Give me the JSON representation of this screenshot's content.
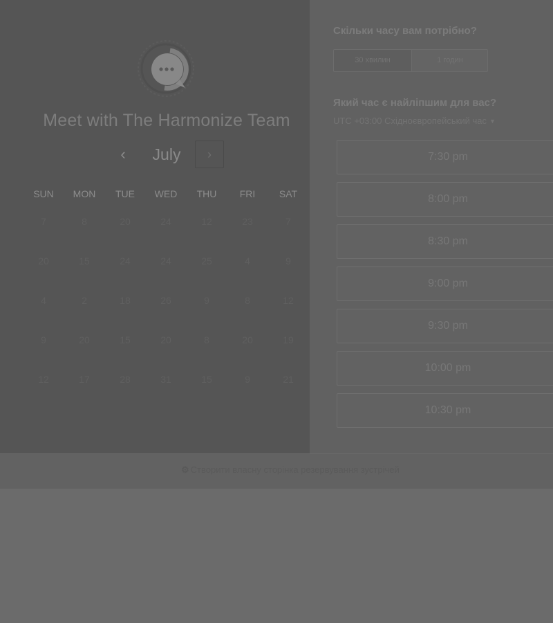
{
  "scheduler": {
    "title": "Meet with The Harmonize Team",
    "month": "July",
    "prev_icon": "‹",
    "next_icon": "›",
    "weekdays": [
      "SUN",
      "MON",
      "TUE",
      "WED",
      "THU",
      "FRI",
      "SAT"
    ],
    "weeks": [
      [
        "7",
        "8",
        "20",
        "24",
        "12",
        "23",
        "7"
      ],
      [
        "20",
        "15",
        "24",
        "24",
        "25",
        "4",
        "9"
      ],
      [
        "4",
        "2",
        "18",
        "26",
        "9",
        "8",
        "12"
      ],
      [
        "9",
        "20",
        "15",
        "20",
        "8",
        "20",
        "19"
      ],
      [
        "12",
        "17",
        "28",
        "31",
        "15",
        "9",
        "21"
      ]
    ]
  },
  "booking": {
    "duration_question": "Скільки часу вам потрібно?",
    "durations": [
      "30 хвилин",
      "1 годин"
    ],
    "time_question": "Який час є найліпшим для вас?",
    "timezone": "UTC +03:00 Східноєвропейський час",
    "slots": [
      "7:30 pm",
      "8:00 pm",
      "8:30 pm",
      "9:00 pm",
      "9:30 pm",
      "10:00 pm",
      "10:30 pm"
    ]
  },
  "footer": {
    "link_text": "Створити власну сторінка резервування зустрічей",
    "icon": "hubspot-sprocket-icon"
  },
  "colors": {
    "overlay": "#6b6b6b",
    "left_panel": "#555555",
    "right_panel": "#616161"
  }
}
